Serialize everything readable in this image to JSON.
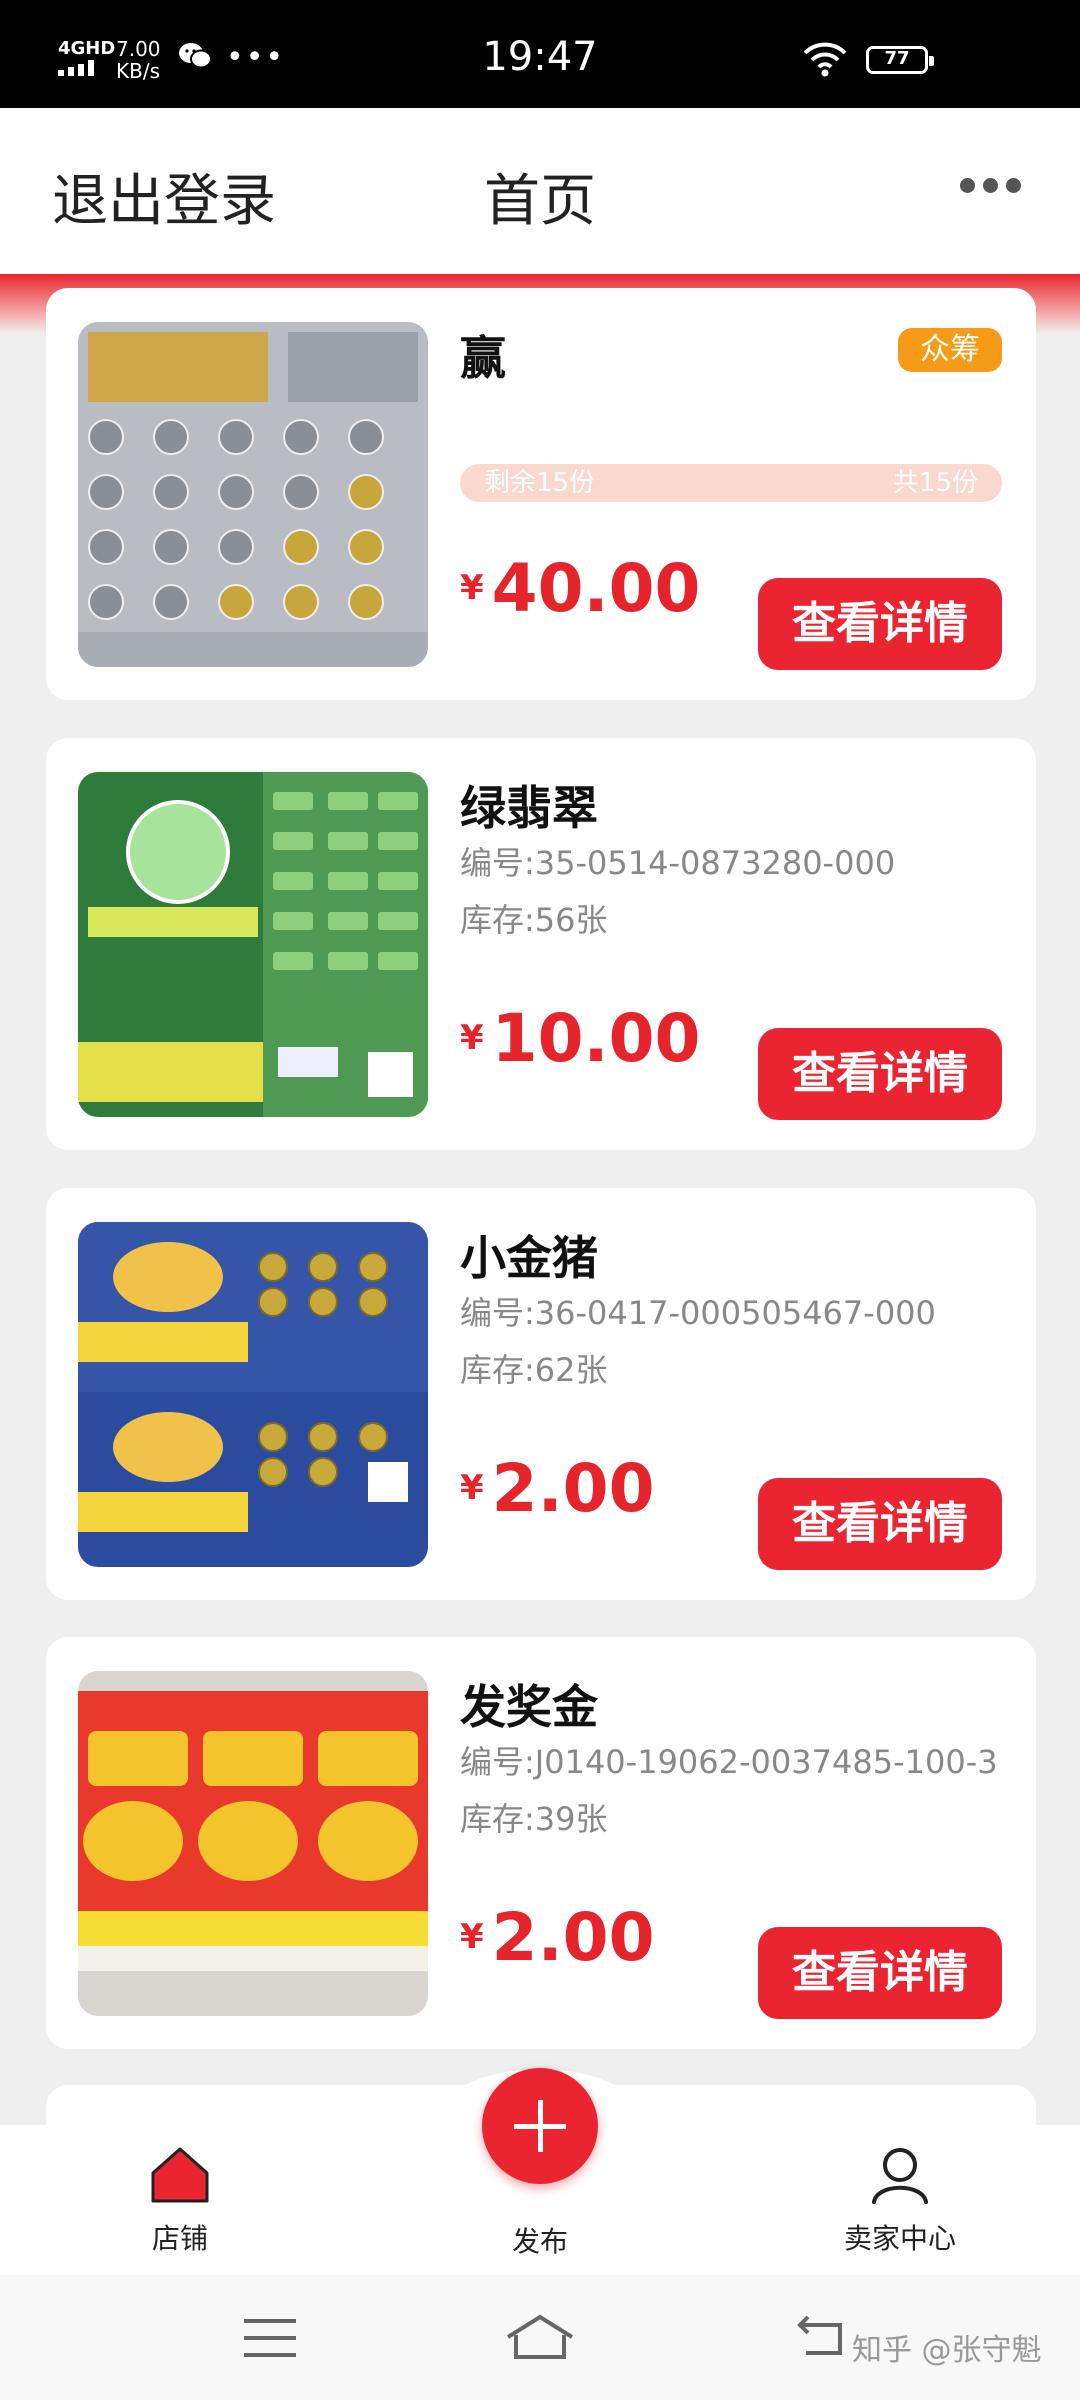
{
  "status_bar": {
    "network": "4GHD",
    "speed": "7.00",
    "speed_unit": "KB/s",
    "time": "19:47",
    "battery": "77"
  },
  "nav": {
    "logout": "退出登录",
    "title": "首页",
    "more_icon": "more-horizontal-icon"
  },
  "products": [
    {
      "name": "赢",
      "badge": "众筹",
      "progress_left": "剩余15份",
      "progress_right": "共15份",
      "currency": "¥",
      "price": "40.00",
      "detail_label": "查看详情",
      "ticket_colors": [
        "#c9ccd2",
        "#8f949c"
      ]
    },
    {
      "name": "绿翡翠",
      "serial": "编号:35-0514-0873280-000",
      "stock": "库存:56张",
      "currency": "¥",
      "price": "10.00",
      "detail_label": "查看详情",
      "ticket_colors": [
        "#2e8a3e",
        "#9bd38c"
      ]
    },
    {
      "name": "小金猪",
      "serial": "编号:36-0417-000505467-000",
      "stock": "库存:62张",
      "currency": "¥",
      "price": "2.00",
      "detail_label": "查看详情",
      "ticket_colors": [
        "#2a4a9c",
        "#f2d03a"
      ]
    },
    {
      "name": "发奖金",
      "serial": "编号:J0140-19062-0037485-100-3",
      "stock": "库存:39张",
      "currency": "¥",
      "price": "2.00",
      "detail_label": "查看详情",
      "ticket_colors": [
        "#e8352b",
        "#f4c22a"
      ]
    }
  ],
  "tabbar": {
    "store": "店铺",
    "publish": "发布",
    "seller": "卖家中心"
  },
  "watermark": "知乎 @张守魁",
  "colors": {
    "accent": "#ea2430",
    "badge": "#f59b17",
    "price": "#e5242c"
  }
}
